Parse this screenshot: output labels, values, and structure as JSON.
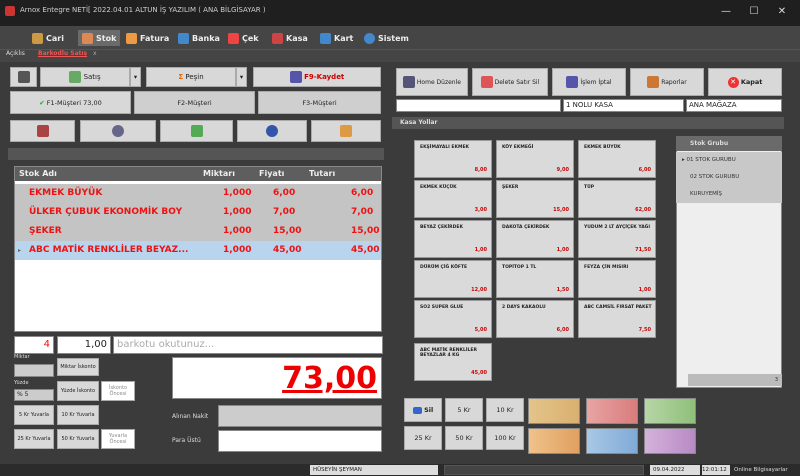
{
  "window": {
    "title": "Arnox Entegre NETİ[ 2022.04.01 ALTUN İŞ YAZILIM ( ANA BİLGİSAYAR )",
    "minimize": "—",
    "maximize": "☐",
    "close": "✕"
  },
  "menu": [
    {
      "label": "Cari",
      "color": "#c94"
    },
    {
      "label": "Stok",
      "color": "#d85"
    },
    {
      "label": "Fatura",
      "color": "#e94"
    },
    {
      "label": "Banka",
      "color": "#48c"
    },
    {
      "label": "Çek",
      "color": "#e44"
    },
    {
      "label": "Kasa",
      "color": "#c44"
    },
    {
      "label": "Kart",
      "color": "#48c"
    },
    {
      "label": "Sistem",
      "color": "#48c"
    }
  ],
  "tabs": {
    "t1": "Açıklıs",
    "t2": "Barkodlu Satış",
    "close": "x"
  },
  "toolbar": {
    "satis": "Satış",
    "pesin": "Peşin",
    "kaydet": "F9-Kaydet",
    "f1": "F1-Müşteri 73,00",
    "f2": "F2-Müşteri",
    "f3": "F3-Müşteri"
  },
  "grid": {
    "headers": [
      "Stok Adı",
      "Miktarı",
      "Fiyatı",
      "Tutarı"
    ],
    "rows": [
      {
        "name": "EKMEK BÜYÜK",
        "qty": "1,000",
        "price": "6,00",
        "total": "6,00"
      },
      {
        "name": "ÜLKER ÇUBUK EKONOMİK BOY",
        "qty": "1,000",
        "price": "7,00",
        "total": "7,00"
      },
      {
        "name": "ŞEKER",
        "qty": "1,000",
        "price": "15,00",
        "total": "15,00"
      },
      {
        "name": "ABC MATİK RENKLİLER BEYAZ...",
        "qty": "1,000",
        "price": "45,00",
        "total": "45,00"
      }
    ]
  },
  "entry": {
    "qty": "4",
    "amount": "1,00",
    "barcode_placeholder": "barkotu okutunuz..."
  },
  "side": {
    "miktar": "Miktar",
    "miktar_iskonto": "Miktar İskonto",
    "yuzde": "Yüzde",
    "yuzde_value": "% 5",
    "yuzde_iskonto": "Yüzde İskonto",
    "iskonto_oncesi": "İskonto Öncesi",
    "y5": "5 Kr Yuvarla",
    "y10": "10 Kr Yuvarla",
    "y25": "25 Kr Yuvarla",
    "y50": "50 Kr Yuvarla",
    "yuvarla_oncesi": "Yuvarla Öncesi"
  },
  "total": "73,00",
  "payment": {
    "alinan": "Alınan Nakit",
    "para": "Para Üstü"
  },
  "top_right": {
    "home": "Home  Düzenle",
    "delete": "Delete Satır Sil",
    "cancel": "İşlem İptal",
    "reports": "Raporlar",
    "close": "Kapat",
    "kasa": "1 NOLU KASA",
    "magaza": "ANA MAĞAZA"
  },
  "kasa_yollar": "Kasa Yollar",
  "tiles": [
    {
      "name": "EKŞİMAYALI EKMEK",
      "price": "8,00"
    },
    {
      "name": "KÖY EKMEĞİ",
      "price": "9,00"
    },
    {
      "name": "EKMEK BÜYÜK",
      "price": "6,00"
    },
    {
      "name": "EKMEK KÜÇÜK",
      "price": "3,00"
    },
    {
      "name": "ŞEKER",
      "price": "15,00"
    },
    {
      "name": "TÜP",
      "price": "62,00"
    },
    {
      "name": "BEYAZ ÇEKİRDEK",
      "price": "1,00"
    },
    {
      "name": "DAKOTA ÇEKİRDEK",
      "price": "1,00"
    },
    {
      "name": "YUDUM 2 LT AYÇİÇEK YAĞI",
      "price": "71,50"
    },
    {
      "name": "DÜRÜM ÇİĞ KÖFTE",
      "price": "12,00"
    },
    {
      "name": "TOPİTOP 1 TL",
      "price": "1,50"
    },
    {
      "name": "FEYZA ÇİN MISIRI",
      "price": "1,00"
    },
    {
      "name": "SO2 SUPER GLUE",
      "price": "5,00"
    },
    {
      "name": "2 DAYS KAKAOLU",
      "price": "6,00"
    },
    {
      "name": "ABC CAMSİL FIRSAT PAKET",
      "price": "7,50"
    },
    {
      "name": "ABC MATİK RENKLİLER BEYAZLAR 4 KG",
      "price": "45,00"
    }
  ],
  "stok_grubu": {
    "header": "Stok Grubu",
    "items": [
      "01 STOK GURUBU",
      "02 STOK GURUBU",
      "KURUYEMİŞ"
    ],
    "count": "3"
  },
  "cash": {
    "sil": "Sil",
    "b5": "5 Kr",
    "b10": "10 Kr",
    "b25": "25 Kr",
    "b50": "50 Kr",
    "b100": "100 Kr"
  },
  "status": {
    "user": "HÜSEYİN ŞEYMAN",
    "date": "09.04.2022",
    "time": "12:01:12",
    "online": "Online Bilgisayarlar"
  }
}
